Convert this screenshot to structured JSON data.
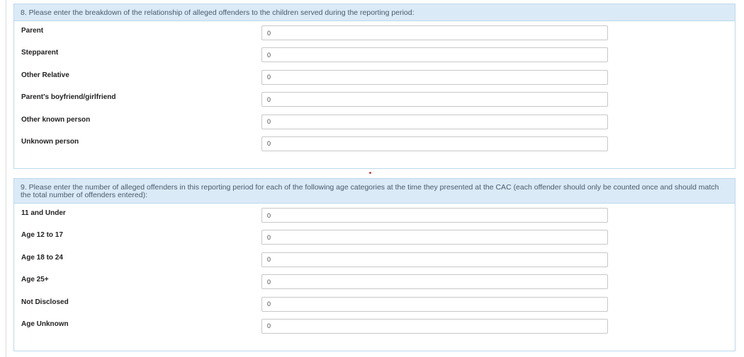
{
  "section8": {
    "question": "8. Please enter the breakdown of the relationship of alleged offenders to the children served during the reporting period:",
    "rows": [
      {
        "label": "Parent",
        "value": "0"
      },
      {
        "label": "Stepparent",
        "value": "0"
      },
      {
        "label": "Other Relative",
        "value": "0"
      },
      {
        "label": "Parent's boyfriend/girlfriend",
        "value": "0"
      },
      {
        "label": "Other known person",
        "value": "0"
      },
      {
        "label": "Unknown person",
        "value": "0"
      }
    ]
  },
  "section9": {
    "question": "9. Please enter the number of alleged offenders in this reporting period for each of the following age categories at the time they presented at the CAC (each offender should only be counted once and should match the total number of offenders entered):",
    "rows": [
      {
        "label": "11 and Under",
        "value": "0"
      },
      {
        "label": "Age 12 to 17",
        "value": "0"
      },
      {
        "label": "Age 18 to 24",
        "value": "0"
      },
      {
        "label": "Age 25+",
        "value": "0"
      },
      {
        "label": "Not Disclosed",
        "value": "0"
      },
      {
        "label": "Age Unknown",
        "value": "0"
      }
    ]
  },
  "colors": {
    "header_bg": "#dbeaf7",
    "panel_border": "#bcd9ec",
    "required_dot": "#e23b3b"
  }
}
